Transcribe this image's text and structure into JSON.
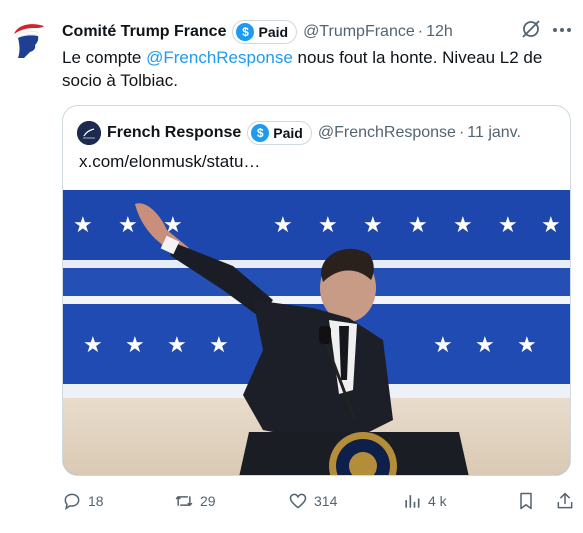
{
  "author": {
    "display_name": "Comité Trump France",
    "badge_label": "Paid",
    "badge_icon": "dollar-coin-icon",
    "handle": "@TrumpFrance",
    "separator": "·",
    "time": "12h"
  },
  "tweet_text": {
    "before": "Le compte ",
    "mention": "@FrenchResponse",
    "after": " nous fout la honte. Niveau L2 de socio à Tolbiac."
  },
  "quote": {
    "display_name": "French Response",
    "badge_label": "Paid",
    "handle": "@FrenchResponse",
    "separator": "·",
    "date": "11 janv.",
    "link_text": "x.com/elonmusk/statu…"
  },
  "actions": {
    "replies": "18",
    "retweets": "29",
    "likes": "314",
    "views": "4 k"
  },
  "colors": {
    "accent": "#1d9bf0",
    "secondary_text": "#536471",
    "border": "#cfd9de"
  }
}
